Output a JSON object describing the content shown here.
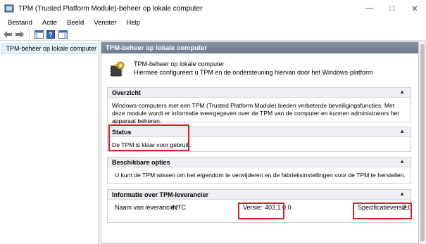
{
  "window": {
    "title": "TPM (Trusted Platform Module)-beheer op lokale computer"
  },
  "menu": [
    "Bestand",
    "Actie",
    "Beeld",
    "Venster",
    "Help"
  ],
  "tree": {
    "root_label": "TPM-beheer op lokale computer"
  },
  "main": {
    "header": "TPM-beheer op lokale computer",
    "intro_title": "TPM-beheer op lokale computer",
    "intro_desc": "Hiermee configureert u TPM en de ondersteuning hiervan door het Windows-platform"
  },
  "sections": {
    "overview": {
      "title": "Overzicht",
      "body": "Windows-computers met een TPM (Trusted Platform Module) bieden verbeterde beveiligingsfuncties. Met deze module wordt er informatie weergegeven over de TPM van de computer en kunnen administrators het apparaat beheren."
    },
    "status": {
      "title": "Status",
      "body": "De TPM is klaar voor gebruik."
    },
    "options": {
      "title": "Beschikbare opties",
      "body": "U kunt de TPM wissen om het eigendom te verwijderen en de fabrieksinstellingen voor de TPM te herstellen."
    },
    "info": {
      "title": "Informatie over TPM-leverancier",
      "vendor_label": "Naam van leverancier:",
      "vendor_value": "INTC",
      "version_label": "Versie:",
      "version_value": "403.1.0.0",
      "spec_label": "Specificatieversie:",
      "spec_value": "2.0"
    }
  },
  "colors": {
    "highlight_box": "#d2232a",
    "header_bar": "#7d8b9c"
  }
}
